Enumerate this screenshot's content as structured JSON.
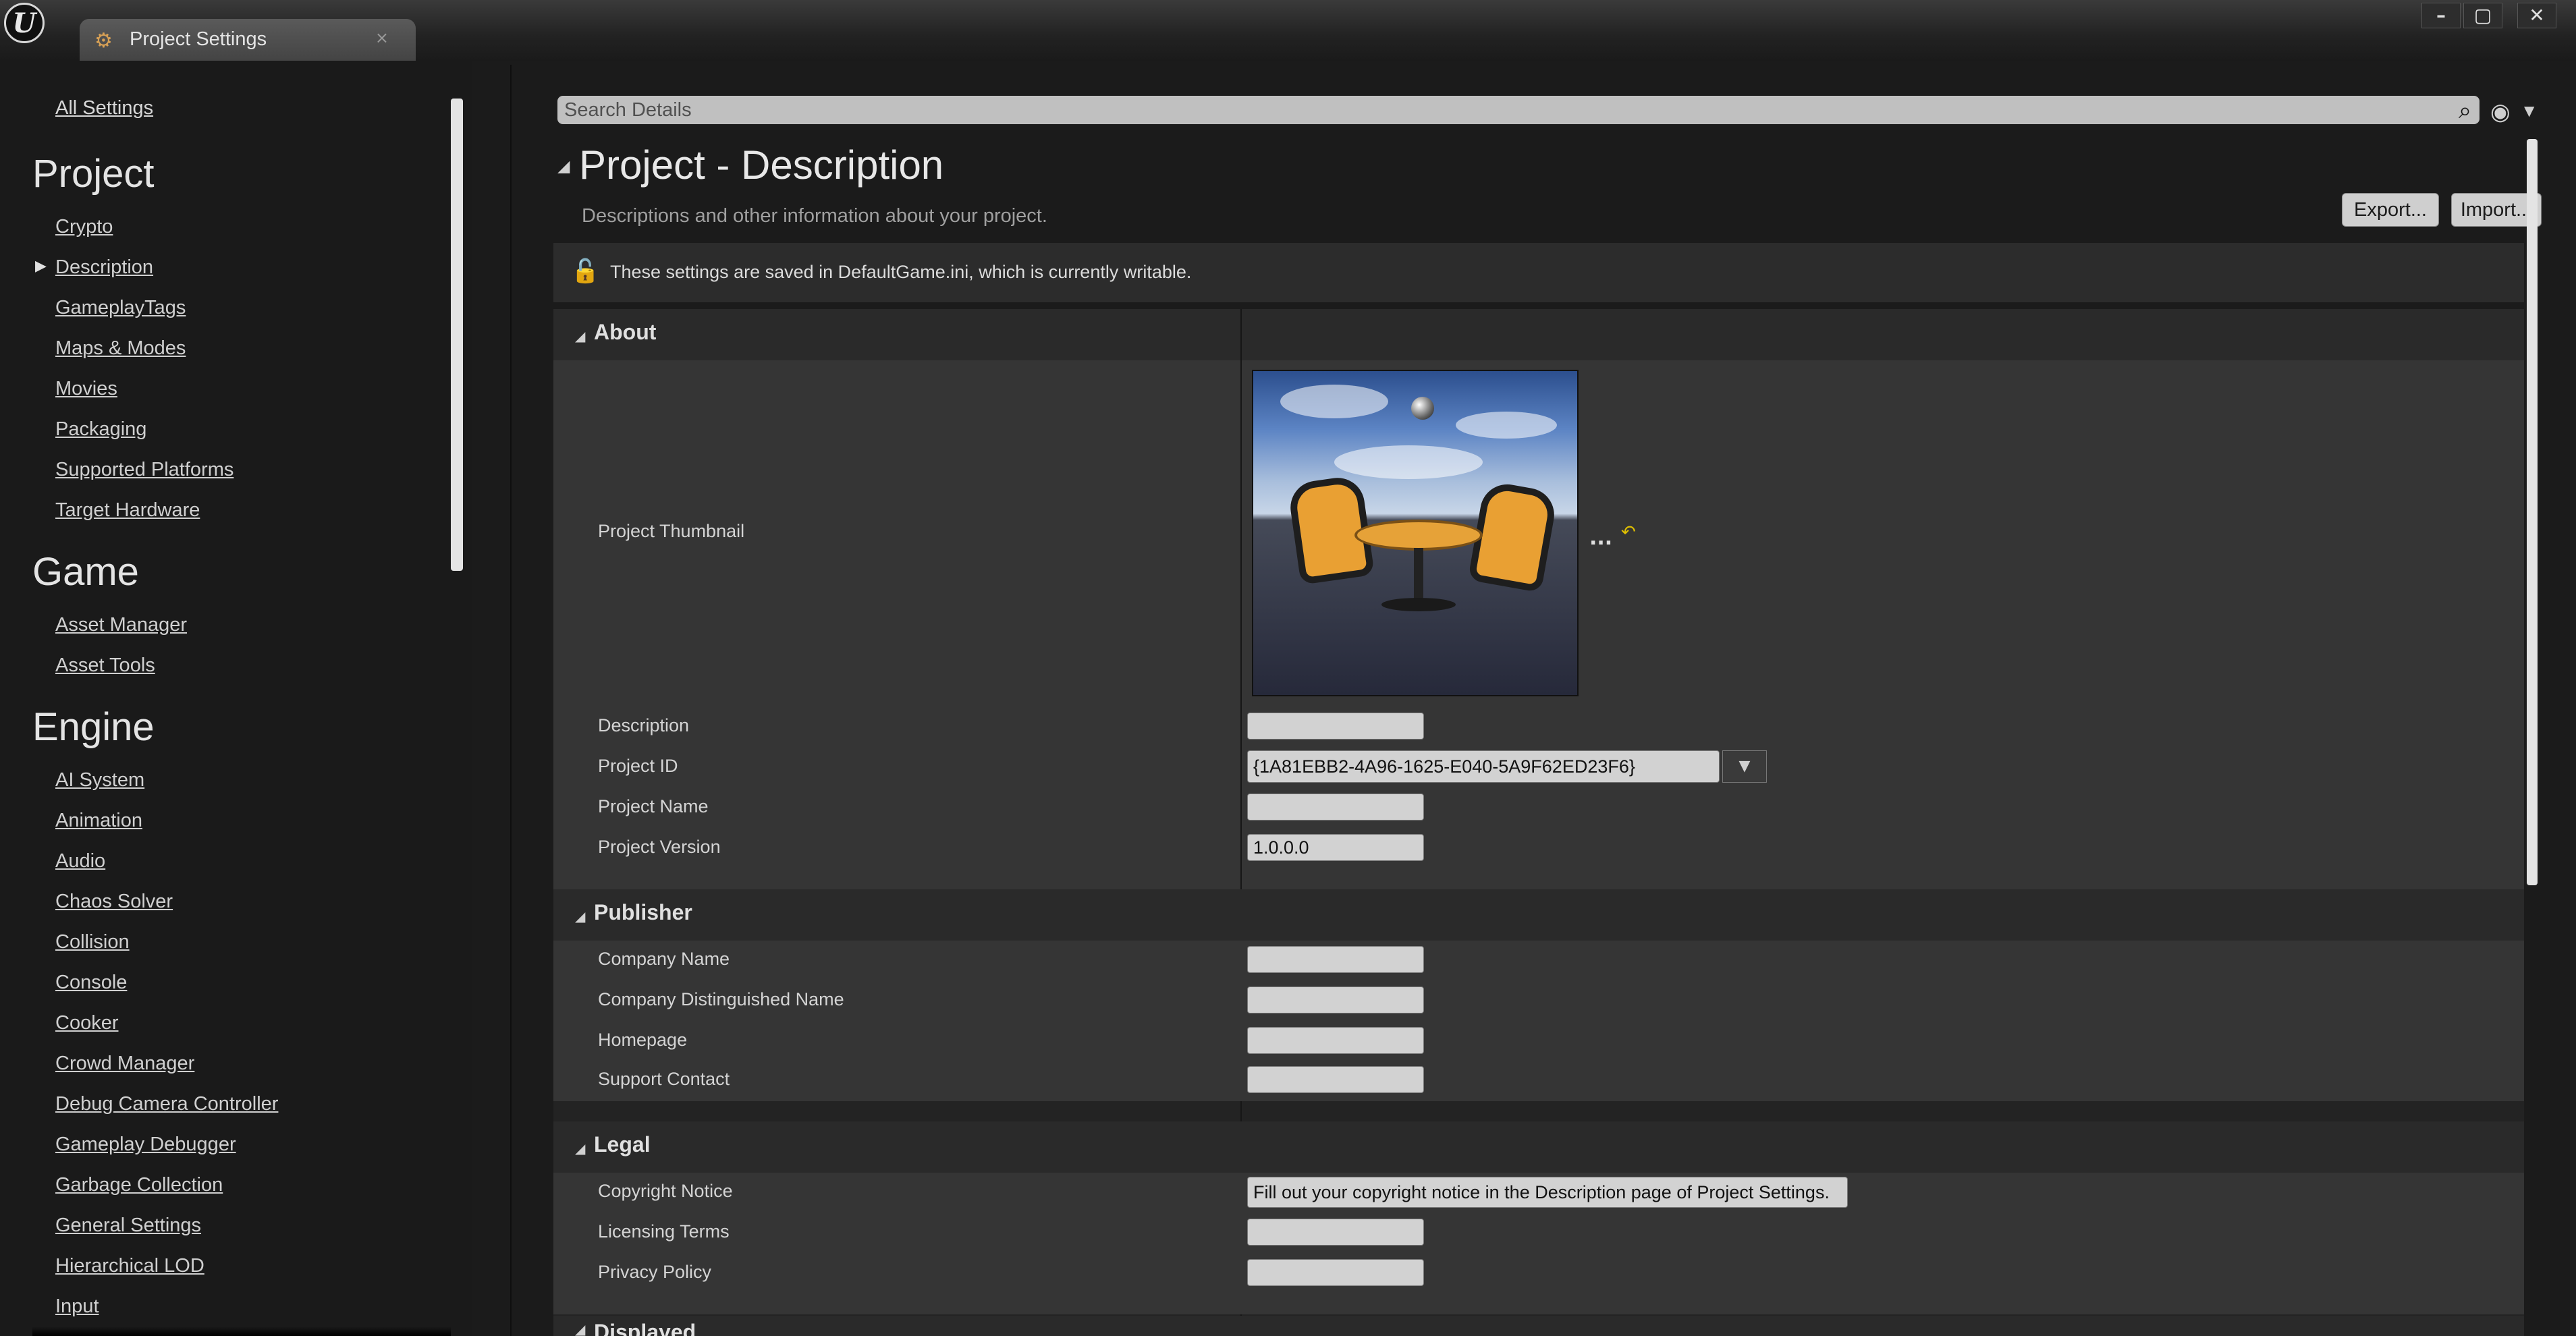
{
  "window": {
    "tab_title": "Project Settings",
    "tab_close": "×",
    "minimize": "–",
    "maximize": "▢",
    "close": "✕"
  },
  "sidebar": {
    "all_settings": "All Settings",
    "sections": [
      {
        "heading": "Project",
        "items": [
          "Crypto",
          "Description",
          "GameplayTags",
          "Maps & Modes",
          "Movies",
          "Packaging",
          "Supported Platforms",
          "Target Hardware"
        ]
      },
      {
        "heading": "Game",
        "items": [
          "Asset Manager",
          "Asset Tools"
        ]
      },
      {
        "heading": "Engine",
        "items": [
          "AI System",
          "Animation",
          "Audio",
          "Chaos Solver",
          "Collision",
          "Console",
          "Cooker",
          "Crowd Manager",
          "Debug Camera Controller",
          "Gameplay Debugger",
          "Garbage Collection",
          "General Settings",
          "Hierarchical LOD",
          "Input"
        ]
      }
    ],
    "selected_item": "Description"
  },
  "search": {
    "placeholder": "Search Details"
  },
  "page": {
    "title": "Project - Description",
    "subtitle": "Descriptions and other information about your project.",
    "export_label": "Export...",
    "import_label": "Import...",
    "notice": "These settings are saved in DefaultGame.ini, which is currently writable."
  },
  "categories": {
    "about": {
      "label": "About",
      "thumbnail_label": "Project Thumbnail",
      "thumbnail_dots": "...",
      "description_label": "Description",
      "description_value": "",
      "project_id_label": "Project ID",
      "project_id_value": "{1A81EBB2-4A96-1625-E040-5A9F62ED23F6}",
      "project_name_label": "Project Name",
      "project_name_value": "",
      "project_version_label": "Project Version",
      "project_version_value": "1.0.0.0"
    },
    "publisher": {
      "label": "Publisher",
      "company_name_label": "Company Name",
      "company_distinguished_label": "Company Distinguished Name",
      "homepage_label": "Homepage",
      "support_contact_label": "Support Contact"
    },
    "legal": {
      "label": "Legal",
      "copyright_label": "Copyright Notice",
      "copyright_value": "Fill out your copyright notice in the Description page of Project Settings.",
      "licensing_label": "Licensing Terms",
      "privacy_label": "Privacy Policy"
    },
    "displayed": {
      "label": "Displayed"
    }
  }
}
